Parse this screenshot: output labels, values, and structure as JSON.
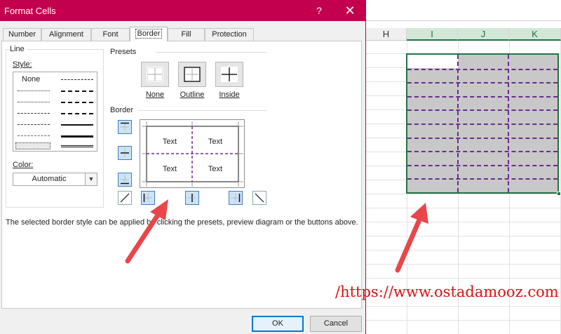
{
  "dialog": {
    "title": "Format Cells",
    "help_glyph": "?",
    "close_glyph": "✕",
    "tabs": [
      {
        "label": "Number",
        "active": false
      },
      {
        "label": "Alignment",
        "active": false
      },
      {
        "label": "Font",
        "active": false
      },
      {
        "label": "Border",
        "active": true
      },
      {
        "label": "Fill",
        "active": false
      },
      {
        "label": "Protection",
        "active": false
      }
    ],
    "line": {
      "group_label": "Line",
      "style_label": "Style:",
      "style_none": "None",
      "color_label": "Color:",
      "color_value": "Automatic"
    },
    "presets": {
      "group_label": "Presets",
      "items": [
        {
          "label": "None",
          "icon": "preset-none-icon"
        },
        {
          "label": "Outline",
          "icon": "preset-outline-icon"
        },
        {
          "label": "Inside",
          "icon": "preset-inside-icon"
        }
      ]
    },
    "border": {
      "group_label": "Border",
      "preview_text": [
        "Text",
        "Text",
        "Text",
        "Text"
      ],
      "buttons": [
        "border-top-icon",
        "border-middle-horizontal-icon",
        "border-bottom-icon",
        "border-diagonal-up-icon",
        "border-left-icon",
        "border-middle-vertical-icon",
        "border-right-icon",
        "border-diagonal-down-icon"
      ]
    },
    "help_text": "The selected border style can be applied by clicking the presets, preview diagram or the buttons above.",
    "ok_label": "OK",
    "cancel_label": "Cancel"
  },
  "sheet": {
    "columns": [
      {
        "label": "H",
        "selected": false
      },
      {
        "label": "I",
        "selected": true
      },
      {
        "label": "J",
        "selected": true
      },
      {
        "label": "K",
        "selected": true
      }
    ]
  },
  "watermark": "/https://www.ostadamooz.com",
  "colors": {
    "title_bar": "#c3004e",
    "selection_border": "#217346",
    "dashed_border": "#6b2d8c",
    "arrow": "#e8474a",
    "watermark": "#d91313"
  }
}
